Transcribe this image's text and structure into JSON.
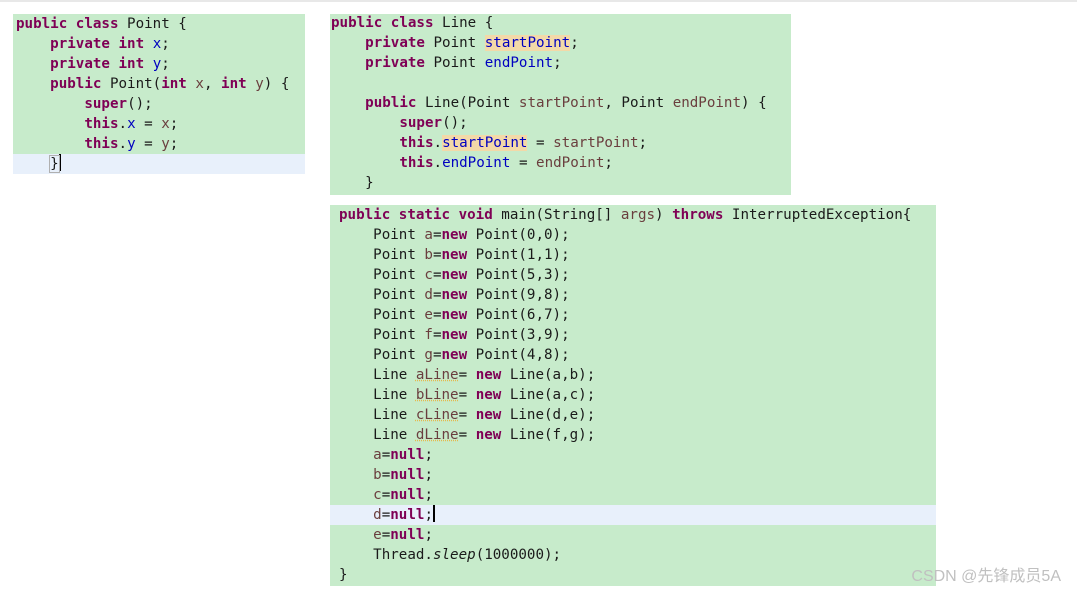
{
  "watermark": "CSDN @先锋成员5A",
  "colors": {
    "panel_bg": "#c7ebcb",
    "highlight_line_bg": "#e8f0fb",
    "keyword": "#7f0055",
    "field": "#0000c0",
    "param": "#6a3e3e"
  },
  "point_class": {
    "lines": [
      {
        "tokens": [
          {
            "t": "public class",
            "s": "kw"
          },
          {
            "t": " Point {"
          }
        ]
      },
      {
        "tokens": [
          {
            "t": "    "
          },
          {
            "t": "private int",
            "s": "kw"
          },
          {
            "t": " "
          },
          {
            "t": "x",
            "s": "field"
          },
          {
            "t": ";"
          }
        ]
      },
      {
        "tokens": [
          {
            "t": "    "
          },
          {
            "t": "private int",
            "s": "kw"
          },
          {
            "t": " "
          },
          {
            "t": "y",
            "s": "field"
          },
          {
            "t": ";"
          }
        ]
      },
      {
        "tokens": [
          {
            "t": "    "
          },
          {
            "t": "public",
            "s": "kw"
          },
          {
            "t": " Point("
          },
          {
            "t": "int",
            "s": "kw"
          },
          {
            "t": " "
          },
          {
            "t": "x",
            "s": "param"
          },
          {
            "t": ", "
          },
          {
            "t": "int",
            "s": "kw"
          },
          {
            "t": " "
          },
          {
            "t": "y",
            "s": "param"
          },
          {
            "t": ") "
          },
          {
            "t": "{",
            "s": "bracket"
          }
        ]
      },
      {
        "tokens": [
          {
            "t": "        "
          },
          {
            "t": "super",
            "s": "kw"
          },
          {
            "t": "();"
          }
        ]
      },
      {
        "tokens": [
          {
            "t": "        "
          },
          {
            "t": "this",
            "s": "kw"
          },
          {
            "t": "."
          },
          {
            "t": "x",
            "s": "field"
          },
          {
            "t": " = "
          },
          {
            "t": "x",
            "s": "param"
          },
          {
            "t": ";"
          }
        ]
      },
      {
        "tokens": [
          {
            "t": "        "
          },
          {
            "t": "this",
            "s": "kw"
          },
          {
            "t": "."
          },
          {
            "t": "y",
            "s": "field"
          },
          {
            "t": " = "
          },
          {
            "t": "y",
            "s": "param"
          },
          {
            "t": ";"
          }
        ]
      },
      {
        "highlight": true,
        "cursor": true,
        "tokens": [
          {
            "t": "    "
          },
          {
            "t": "}",
            "s": "bracket"
          }
        ]
      }
    ]
  },
  "line_class": {
    "lines": [
      {
        "tokens": [
          {
            "t": "public class",
            "s": "kw"
          },
          {
            "t": " Line {"
          }
        ]
      },
      {
        "tokens": [
          {
            "t": "    "
          },
          {
            "t": "private",
            "s": "kw"
          },
          {
            "t": " Point "
          },
          {
            "t": "startPoint",
            "s": "field occ"
          },
          {
            "t": ";"
          }
        ]
      },
      {
        "tokens": [
          {
            "t": "    "
          },
          {
            "t": "private",
            "s": "kw"
          },
          {
            "t": " Point "
          },
          {
            "t": "endPoint",
            "s": "field"
          },
          {
            "t": ";"
          }
        ]
      },
      {
        "tokens": [
          {
            "t": ""
          }
        ]
      },
      {
        "tokens": [
          {
            "t": "    "
          },
          {
            "t": "public",
            "s": "kw"
          },
          {
            "t": " Line(Point "
          },
          {
            "t": "startPoint",
            "s": "param"
          },
          {
            "t": ", Point "
          },
          {
            "t": "endPoint",
            "s": "param"
          },
          {
            "t": ") {"
          }
        ]
      },
      {
        "tokens": [
          {
            "t": "        "
          },
          {
            "t": "super",
            "s": "kw"
          },
          {
            "t": "();"
          }
        ]
      },
      {
        "tokens": [
          {
            "t": "        "
          },
          {
            "t": "this",
            "s": "kw"
          },
          {
            "t": "."
          },
          {
            "t": "startPoint",
            "s": "field occ"
          },
          {
            "t": " = "
          },
          {
            "t": "startPoint",
            "s": "param"
          },
          {
            "t": ";"
          }
        ]
      },
      {
        "tokens": [
          {
            "t": "        "
          },
          {
            "t": "this",
            "s": "kw"
          },
          {
            "t": "."
          },
          {
            "t": "endPoint",
            "s": "field"
          },
          {
            "t": " = "
          },
          {
            "t": "endPoint",
            "s": "param"
          },
          {
            "t": ";"
          }
        ]
      },
      {
        "tokens": [
          {
            "t": "    }"
          }
        ]
      }
    ]
  },
  "main_method": {
    "lines": [
      {
        "tokens": [
          {
            "t": "public static void",
            "s": "kw"
          },
          {
            "t": " main(String[] "
          },
          {
            "t": "args",
            "s": "param"
          },
          {
            "t": ") "
          },
          {
            "t": "throws",
            "s": "kw"
          },
          {
            "t": " InterruptedException{"
          }
        ]
      },
      {
        "tokens": [
          {
            "t": "    Point "
          },
          {
            "t": "a",
            "s": "param"
          },
          {
            "t": "="
          },
          {
            "t": "new",
            "s": "kw"
          },
          {
            "t": " Point(0,0);"
          }
        ]
      },
      {
        "tokens": [
          {
            "t": "    Point "
          },
          {
            "t": "b",
            "s": "param"
          },
          {
            "t": "="
          },
          {
            "t": "new",
            "s": "kw"
          },
          {
            "t": " Point(1,1);"
          }
        ]
      },
      {
        "tokens": [
          {
            "t": "    Point "
          },
          {
            "t": "c",
            "s": "param"
          },
          {
            "t": "="
          },
          {
            "t": "new",
            "s": "kw"
          },
          {
            "t": " Point(5,3);"
          }
        ]
      },
      {
        "tokens": [
          {
            "t": "    Point "
          },
          {
            "t": "d",
            "s": "param"
          },
          {
            "t": "="
          },
          {
            "t": "new",
            "s": "kw"
          },
          {
            "t": " Point(9,8);"
          }
        ]
      },
      {
        "tokens": [
          {
            "t": "    Point "
          },
          {
            "t": "e",
            "s": "param"
          },
          {
            "t": "="
          },
          {
            "t": "new",
            "s": "kw"
          },
          {
            "t": " Point(6,7);"
          }
        ]
      },
      {
        "tokens": [
          {
            "t": "    Point "
          },
          {
            "t": "f",
            "s": "param"
          },
          {
            "t": "="
          },
          {
            "t": "new",
            "s": "kw"
          },
          {
            "t": " Point(3,9);"
          }
        ]
      },
      {
        "tokens": [
          {
            "t": "    Point "
          },
          {
            "t": "g",
            "s": "param"
          },
          {
            "t": "="
          },
          {
            "t": "new",
            "s": "kw"
          },
          {
            "t": " Point(4,8);"
          }
        ]
      },
      {
        "tokens": [
          {
            "t": "    Line "
          },
          {
            "t": "aLine",
            "s": "param warn"
          },
          {
            "t": "= "
          },
          {
            "t": "new",
            "s": "kw"
          },
          {
            "t": " Line(a,b);"
          }
        ]
      },
      {
        "tokens": [
          {
            "t": "    Line "
          },
          {
            "t": "bLine",
            "s": "param warn"
          },
          {
            "t": "= "
          },
          {
            "t": "new",
            "s": "kw"
          },
          {
            "t": " Line(a,c);"
          }
        ]
      },
      {
        "tokens": [
          {
            "t": "    Line "
          },
          {
            "t": "cLine",
            "s": "param warn"
          },
          {
            "t": "= "
          },
          {
            "t": "new",
            "s": "kw"
          },
          {
            "t": " Line(d,e);"
          }
        ]
      },
      {
        "tokens": [
          {
            "t": "    Line "
          },
          {
            "t": "dLine",
            "s": "param warn"
          },
          {
            "t": "= "
          },
          {
            "t": "new",
            "s": "kw"
          },
          {
            "t": " Line(f,g);"
          }
        ]
      },
      {
        "tokens": [
          {
            "t": "    "
          },
          {
            "t": "a",
            "s": "param"
          },
          {
            "t": "="
          },
          {
            "t": "null",
            "s": "kw"
          },
          {
            "t": ";"
          }
        ]
      },
      {
        "tokens": [
          {
            "t": "    "
          },
          {
            "t": "b",
            "s": "param"
          },
          {
            "t": "="
          },
          {
            "t": "null",
            "s": "kw"
          },
          {
            "t": ";"
          }
        ]
      },
      {
        "tokens": [
          {
            "t": "    "
          },
          {
            "t": "c",
            "s": "param"
          },
          {
            "t": "="
          },
          {
            "t": "null",
            "s": "kw"
          },
          {
            "t": ";"
          }
        ]
      },
      {
        "highlight": true,
        "cursor": true,
        "tokens": [
          {
            "t": "    "
          },
          {
            "t": "d",
            "s": "param"
          },
          {
            "t": "="
          },
          {
            "t": "null",
            "s": "kw"
          },
          {
            "t": ";"
          }
        ]
      },
      {
        "tokens": [
          {
            "t": "    "
          },
          {
            "t": "e",
            "s": "param"
          },
          {
            "t": "="
          },
          {
            "t": "null",
            "s": "kw"
          },
          {
            "t": ";"
          }
        ]
      },
      {
        "tokens": [
          {
            "t": "    Thread."
          },
          {
            "t": "sleep",
            "s": "italic"
          },
          {
            "t": "(1000000);"
          }
        ]
      },
      {
        "tokens": [
          {
            "t": "}"
          }
        ]
      }
    ]
  }
}
